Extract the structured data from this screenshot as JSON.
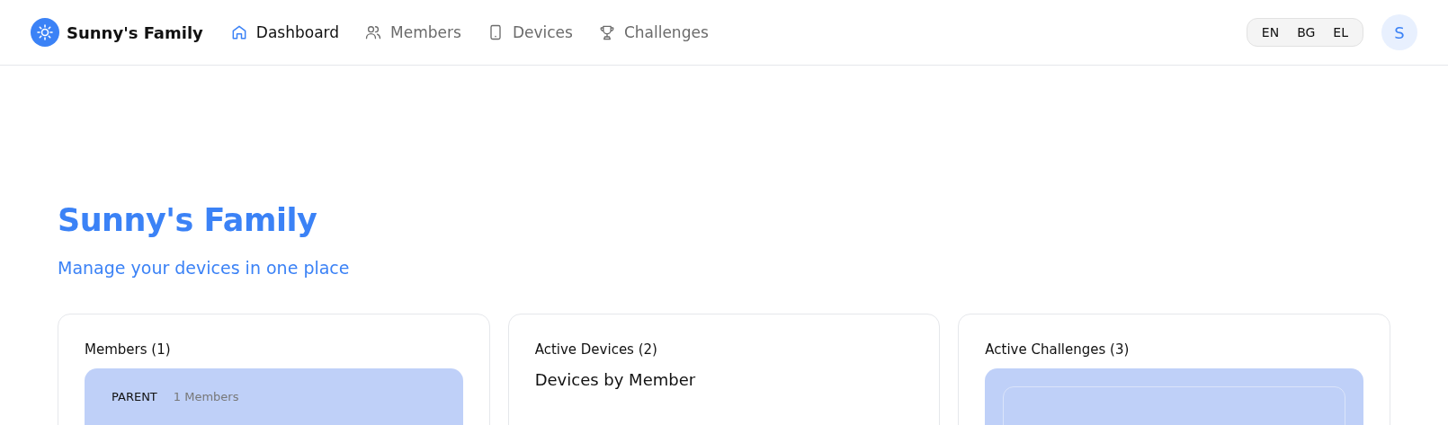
{
  "brand": {
    "name": "Sunny's Family"
  },
  "nav": [
    {
      "label": "Dashboard",
      "kind": "home",
      "selected": true
    },
    {
      "label": "Members",
      "kind": "users",
      "selected": false
    },
    {
      "label": "Devices",
      "kind": "device",
      "selected": false
    },
    {
      "label": "Challenges",
      "kind": "trophy",
      "selected": false
    }
  ],
  "languages": [
    "EN",
    "BG",
    "EL"
  ],
  "avatar": {
    "initial": "S"
  },
  "page": {
    "title": "Sunny's Family",
    "subtitle": "Manage your devices in one place"
  },
  "cards": [
    {
      "kind": "members",
      "title": "Members (1)",
      "group": {
        "role": "PARENT",
        "count": "1 Members"
      }
    },
    {
      "kind": "devices",
      "title": "Active Devices (2)",
      "subheading": "Devices by Member"
    },
    {
      "kind": "challenges",
      "title": "Active Challenges (3)"
    }
  ]
}
